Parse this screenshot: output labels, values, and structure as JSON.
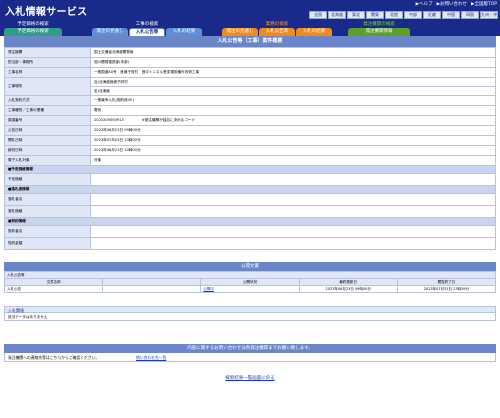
{
  "app": {
    "title": "入札情報サービス"
  },
  "toplinks": [
    "▶ヘルプ",
    "▶お問い合わせ",
    "▶全国版TOP"
  ],
  "regions": [
    "全国",
    "北海道",
    "東北",
    "関東",
    "北陸",
    "中部",
    "近畿",
    "中国",
    "四国",
    "九州・沖"
  ],
  "nav": {
    "groups": [
      {
        "label": "予定価格の検索",
        "color": "#ffffff",
        "tabs": [
          {
            "label": "予定価格の検索",
            "color": "#2f9d8a",
            "selected": false
          }
        ]
      },
      {
        "label": "工事の検索",
        "color": "#ffffff",
        "tabs": [
          {
            "label": "発注の見通し",
            "color": "#5c8fd8",
            "selected": false
          },
          {
            "label": "入札公告等",
            "color": "#1a2a8a",
            "selected": true
          },
          {
            "label": "入札の結果",
            "color": "#5c8fd8",
            "selected": false
          }
        ]
      },
      {
        "label": "業務の検索",
        "color": "#ff9a1a",
        "tabs": [
          {
            "label": "発注の見通し",
            "color": "#f08a1a",
            "selected": false
          },
          {
            "label": "入札公告等",
            "color": "#f08a1a",
            "selected": false
          },
          {
            "label": "入札の結果",
            "color": "#f08a1a",
            "selected": false
          }
        ]
      },
      {
        "label": "発注機関の検索",
        "color": "#7ad23a",
        "tabs": [
          {
            "label": "発注機関情報",
            "color": "#5aa02a",
            "selected": false
          }
        ]
      }
    ]
  },
  "main": {
    "section_title": "入札公告等（工事）案件概要",
    "rows": [
      {
        "label": "発注機関",
        "value": "国土交通省北海道開発局"
      },
      {
        "label": "担当部・事務所",
        "value": "旭川開発建設部(本部)"
      },
      {
        "label": "工事名称",
        "value": "一般国道40号　音威子府村　音中トンネル受変電設備外改修工事"
      },
      {
        "label": "工事場所",
        "value": "自)北海道音威子府村",
        "value2": "至)北海道"
      },
      {
        "label": "入札契約方式",
        "value": "一般競争入札(契約後VE)"
      },
      {
        "label": "工事種別／工事の業種",
        "value": "電気"
      },
      {
        "label": "調達番号",
        "value": "2023200000913",
        "hint": "※発注機関が独自に決めるコード"
      },
      {
        "label": "公告日時",
        "value": "2023年06月23日 09時00分"
      },
      {
        "label": "開札日時",
        "value": "2023年07月03日 13時00分"
      },
      {
        "label": "締切日時",
        "value": "2023年06月23日 10時00分"
      },
      {
        "label": "電子入札対象",
        "value": "対象"
      }
    ],
    "section_yotei": "■予定価格情報",
    "yotei_rows": [
      {
        "label": "予定価格",
        "value": ""
      }
    ],
    "section_rakusatsu": "■落札者情報",
    "rakusatsu_rows": [
      {
        "label": "落札者名",
        "value": ""
      },
      {
        "label": "落札価格",
        "value": ""
      }
    ],
    "section_keiyaku": "■契約情報",
    "keiyaku_rows": [
      {
        "label": "契約者名",
        "value": ""
      },
      {
        "label": "契約金額",
        "value": ""
      }
    ]
  },
  "docs": {
    "title": "公開文書",
    "section_label": "入札公告等",
    "headers": [
      "文書名称",
      "公開状況",
      "最終更新日",
      "閲覧終了日"
    ],
    "rows": [
      {
        "name": "入札公告",
        "status": "公開中",
        "updated": "2023年06月23日 09時00分",
        "end": "2023年07月31日 23時59分"
      }
    ]
  },
  "info": {
    "title": "入札関連",
    "body": "該当データはありません"
  },
  "inquiry": {
    "title": "内容に関するお問い合わせは各発注機関までお願い致します。",
    "label": "発注機関への連絡先等はこちらからご確認ください。",
    "link": "問い合わせ先一覧"
  },
  "back_link": "検索結果一覧画面に戻る"
}
